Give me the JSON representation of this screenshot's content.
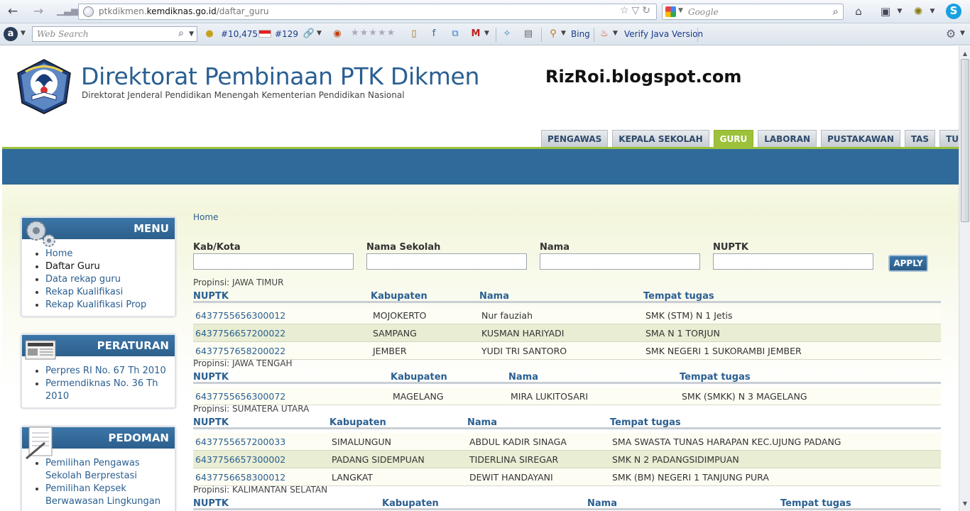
{
  "browser": {
    "url_prefix": "ptkdikmen.",
    "url_domain": "kemdiknas.go.id",
    "url_path": "/daftar_guru",
    "search_placeholder": "Google",
    "web_search_placeholder": "Web Search",
    "rank_global": "#10,475",
    "rank_local": "#129",
    "bing_label": "Bing",
    "java_label": "Verify Java Version"
  },
  "site": {
    "title": "Direktorat Pembinaan PTK Dikmen",
    "subtitle": "Direktorat Jenderal Pendidikan Menengah Kementerian Pendidikan Nasional",
    "watermark": "RizRoi.blogspot.com"
  },
  "tabs": [
    {
      "label": "PENGAWAS"
    },
    {
      "label": "KEPALA SEKOLAH"
    },
    {
      "label": "GURU",
      "active": true
    },
    {
      "label": "LABORAN"
    },
    {
      "label": "PUSTAKAWAN"
    },
    {
      "label": "TAS"
    },
    {
      "label": "TUNJANGAN"
    }
  ],
  "sidebar": {
    "menu": {
      "title": "MENU",
      "items": [
        "Home",
        "Daftar Guru",
        "Data rekap guru",
        "Rekap Kualifikasi",
        "Rekap Kualifikasi Prop"
      ]
    },
    "peraturan": {
      "title": "PERATURAN",
      "items": [
        "Perpres RI No. 67 Th 2010",
        "Permendiknas No. 36 Th",
        "2010"
      ]
    },
    "pedoman": {
      "title": "PEDOMAN",
      "items": [
        "Pemilihan Pengawas",
        "Sekolah Berprestasi",
        "Pemilihan Kepsek",
        "Berwawasan Lingkungan"
      ]
    }
  },
  "breadcrumb": "Home",
  "filters": {
    "kab_label": "Kab/Kota",
    "sekolah_label": "Nama Sekolah",
    "nama_label": "Nama",
    "nuptk_label": "NUPTK",
    "apply_label": "APPLY"
  },
  "columns": {
    "nuptk": "NUPTK",
    "kabupaten": "Kabupaten",
    "nama": "Nama",
    "tempat": "Tempat tugas"
  },
  "groups": [
    {
      "province": "Propinsi: JAWA TIMUR",
      "rows": [
        {
          "nuptk": "6437755656300012",
          "kabupaten": "MOJOKERTO",
          "nama": "Nur fauziah",
          "tempat": "SMK (STM) N 1 Jetis"
        },
        {
          "nuptk": "6437756657200022",
          "kabupaten": "SAMPANG",
          "nama": "KUSMAN HARIYADI",
          "tempat": "SMA N 1 TORJUN"
        },
        {
          "nuptk": "6437757658200022",
          "kabupaten": "JEMBER",
          "nama": "YUDI TRI SANTORO",
          "tempat": "SMK NEGERI 1 SUKORAMBI JEMBER"
        }
      ]
    },
    {
      "province": "Propinsi: JAWA TENGAH",
      "rows": [
        {
          "nuptk": "6437755656300072",
          "kabupaten": "MAGELANG",
          "nama": "MIRA LUKITOSARI",
          "tempat": "SMK (SMKK) N 3 MAGELANG"
        }
      ]
    },
    {
      "province": "Propinsi: SUMATERA UTARA",
      "rows": [
        {
          "nuptk": "6437755657200033",
          "kabupaten": "SIMALUNGUN",
          "nama": "ABDUL KADIR SINAGA",
          "tempat": "SMA SWASTA TUNAS HARAPAN KEC.UJUNG PADANG"
        },
        {
          "nuptk": "6437756657300002",
          "kabupaten": "PADANG SIDEMPUAN",
          "nama": "TIDERLINA SIREGAR",
          "tempat": "SMK N 2 PADANGSIDIMPUAN"
        },
        {
          "nuptk": "6437756658300012",
          "kabupaten": "LANGKAT",
          "nama": "DEWIT HANDAYANI",
          "tempat": "SMK (BM) NEGERI 1 TANJUNG PURA"
        }
      ]
    },
    {
      "province": "Propinsi: KALIMANTAN SELATAN",
      "rows": []
    }
  ]
}
